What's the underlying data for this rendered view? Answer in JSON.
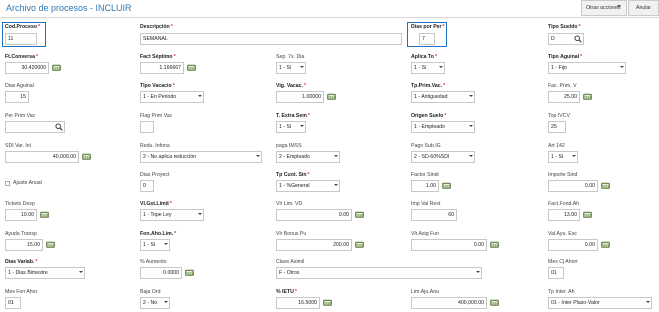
{
  "header": {
    "title": "Archivo de procesos - INCLUIR",
    "acciones_label": "Otras acciones",
    "anular_label": "Anular"
  },
  "fields": {
    "cod_proceso": {
      "label": "Cod.Proceso",
      "value": "11"
    },
    "descripcion": {
      "label": "Descripción",
      "value": "SEMANAL"
    },
    "dias_por_per": {
      "label": "Dias por Per",
      "value": "7"
    },
    "tipo_sueldo": {
      "label": "Tipo Sueldo",
      "value": "D"
    },
    "ft_conversa": {
      "label": "Ft.Conversa",
      "value": "30.420000"
    },
    "fact_septimo": {
      "label": "Fact Séptimo",
      "value": "1.166667"
    },
    "sep_7s_dia": {
      "label": "Sep. 7s. Dia",
      "value": "1 - Si"
    },
    "aplica_to": {
      "label": "Aplica To",
      "value": "1 - Si"
    },
    "tipo_aguinal": {
      "label": "Tipo Aguinal",
      "value": "1 - Fijo"
    },
    "dias_aguinal": {
      "label": "Dias Aguinal",
      "value": "15"
    },
    "tipo_vacacio": {
      "label": "Tipo Vacacio",
      "value": "1 - En Periodo"
    },
    "vig_vacac": {
      "label": "Vig. Vacac.",
      "value": "1.00000"
    },
    "tp_prim_vac": {
      "label": "Tp.Prim.Vac.",
      "value": "1 - Antiguedad"
    },
    "fac_prim_v": {
      "label": "Fac. Prim. V",
      "value": "25.00"
    },
    "per_prim_vac": {
      "label": "Per Prim Vac",
      "value": ""
    },
    "flag_prim_vac": {
      "label": "Flag Prim Vac",
      "value": ""
    },
    "t_extra_sem": {
      "label": "T. Extra Sem",
      "value": "1 - Si"
    },
    "origen_suelo": {
      "label": "Origen Suelo",
      "value": "1 - Empleado"
    },
    "top_ivcv": {
      "label": "Top IVCV",
      "value": "25"
    },
    "sdi_var_ini": {
      "label": "SDI Var. Ini",
      "value": "40,000.00"
    },
    "redu_infona": {
      "label": "Redu. Infona",
      "value": "2 - No aplica reducción"
    },
    "paga_imss": {
      "label": "paga IMSS",
      "value": "2 - Empleado"
    },
    "pago_sub_ig": {
      "label": "Pago Sub.IG",
      "value": "2 - SD-60%SDI"
    },
    "art_142": {
      "label": "Art 142",
      "value": "1 - Si"
    },
    "ajuste_anual": {
      "label": "Ajuste Anual"
    },
    "dias_proyect": {
      "label": "Dias Proyect",
      "value": "0"
    },
    "tp_cuot_sin": {
      "label": "Tp Cuot. Sin",
      "value": "1 - %General"
    },
    "factor_sindi": {
      "label": "Factor Sindi",
      "value": "1.00"
    },
    "importe_sind": {
      "label": "Importe Sind",
      "value": "0.00"
    },
    "tickets_desp": {
      "label": "Tickets Desp",
      "value": "10.00"
    },
    "vl_gst_limit": {
      "label": "Vl.Gst.Limit",
      "value": "1 - Tope Ley"
    },
    "vlr_lim_vd": {
      "label": "Vlr Lim. VD",
      "value": "0.00"
    },
    "imp_val_rest": {
      "label": "Imp Val Rest",
      "value": "60"
    },
    "fact_fond_ah": {
      "label": "Fact.Fond.Ah",
      "value": "13.00"
    },
    "ayuda_transp": {
      "label": "Ayuda Transp",
      "value": "15.00"
    },
    "fon_aho_lim": {
      "label": "Fon.Aho.Lim.",
      "value": "1 - Si"
    },
    "vlr_bonus_pu": {
      "label": "Vlr Bonus Pu",
      "value": "200.00"
    },
    "vlr_asig_fun": {
      "label": "Vlr.Asig Fun",
      "value": "0.00"
    },
    "val_ayu_esc": {
      "label": "Val.Ayu. Esc",
      "value": "0.00"
    },
    "dias_variab": {
      "label": "Dias Variab.",
      "value": "1 - Dias Bimestre"
    },
    "pct_aumento": {
      "label": "% Aumento",
      "value": "0.0000"
    },
    "clave_asimil": {
      "label": "Clave Asimil",
      "value": "F - Otros"
    },
    "mes_cj_ahorr": {
      "label": "Mes Cj Ahorr",
      "value": "01"
    },
    "mes_fon_ahor": {
      "label": "Mes Fon Ahor",
      "value": "01"
    },
    "baja_ord": {
      "label": "Baja Ord",
      "value": "2 - No"
    },
    "pct_ietu": {
      "label": "% IETU",
      "value": "16.5000"
    },
    "lim_aju_anu": {
      "label": "Lim.Aju.Anu",
      "value": "400,000.00"
    },
    "tp_inter_ah": {
      "label": "Tp Inter. Ah",
      "value": "01 - Inter Plazo-Valor"
    }
  },
  "colors": {
    "accent": "#1f73c2",
    "title": "#2f78b5",
    "required": "#d9352c",
    "calc_icon": "#6b8e4e"
  }
}
